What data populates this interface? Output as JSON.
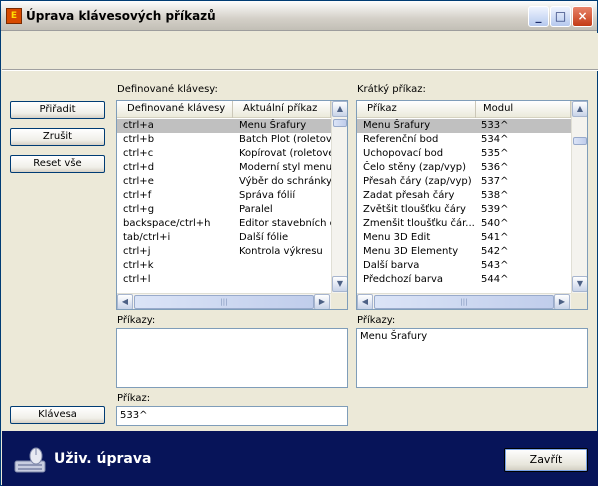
{
  "window": {
    "title": "Úprava klávesových příkazů",
    "icon_label": "E",
    "controls": {
      "minimize": "_",
      "maximize": "□",
      "close": "×"
    }
  },
  "left": {
    "section_label": "Definované klávesy:",
    "buttons": {
      "assign": "Přiřadit",
      "cancel": "Zrušit",
      "reset_all": "Reset vše",
      "key": "Klávesa"
    },
    "table": {
      "columns": [
        "Definované klávesy",
        "Aktuální příkaz"
      ],
      "rows": [
        {
          "key": "ctrl+a",
          "command": "Menu Šrafury",
          "selected": true
        },
        {
          "key": "ctrl+b",
          "command": "Batch Plot (roletové"
        },
        {
          "key": "ctrl+c",
          "command": "Kopírovat (roletové"
        },
        {
          "key": "ctrl+d",
          "command": "Moderní styl menu"
        },
        {
          "key": "ctrl+e",
          "command": "Výběr do schránky"
        },
        {
          "key": "ctrl+f",
          "command": "Správa fólií"
        },
        {
          "key": "ctrl+g",
          "command": "Paralel"
        },
        {
          "key": "backspace/ctrl+h",
          "command": "Editor stavebních e"
        },
        {
          "key": "tab/ctrl+i",
          "command": "Další fólie"
        },
        {
          "key": "ctrl+j",
          "command": "Kontrola výkresu"
        },
        {
          "key": "ctrl+k",
          "command": ""
        },
        {
          "key": "ctrl+l",
          "command": ""
        }
      ]
    },
    "commands_label": "Příkazy:",
    "commands_value": "",
    "command_label": "Příkaz:",
    "command_value": "533^"
  },
  "right": {
    "section_label": "Krátký příkaz:",
    "table": {
      "columns": [
        "Příkaz",
        "Modul"
      ],
      "rows": [
        {
          "cmd": "Menu Šrafury",
          "module": "533^",
          "selected": true
        },
        {
          "cmd": "Referenční bod",
          "module": "534^"
        },
        {
          "cmd": "Uchopovací bod",
          "module": "535^"
        },
        {
          "cmd": "Čelo stěny (zap/vyp)",
          "module": "536^"
        },
        {
          "cmd": "Přesah čáry (zap/vyp)",
          "module": "537^"
        },
        {
          "cmd": "Zadat přesah čáry",
          "module": "538^"
        },
        {
          "cmd": "Zvětšit tloušťku čáry",
          "module": "539^"
        },
        {
          "cmd": "Zmenšit tloušťku čár...",
          "module": "540^"
        },
        {
          "cmd": "Menu 3D Edit",
          "module": "541^"
        },
        {
          "cmd": "Menu 3D Elementy",
          "module": "542^"
        },
        {
          "cmd": "Další barva",
          "module": "543^"
        },
        {
          "cmd": "Předchozí barva",
          "module": "544^"
        }
      ]
    },
    "commands_label": "Příkazy:",
    "commands_value": "Menu Šrafury"
  },
  "scroll_glyphs": {
    "up": "▲",
    "down": "▼",
    "left": "◀",
    "right": "▶",
    "grip": "|||"
  },
  "footer": {
    "title": "Uživ. úprava",
    "close_button": "Zavřít",
    "icon": "mouse-keyboard-icon"
  }
}
